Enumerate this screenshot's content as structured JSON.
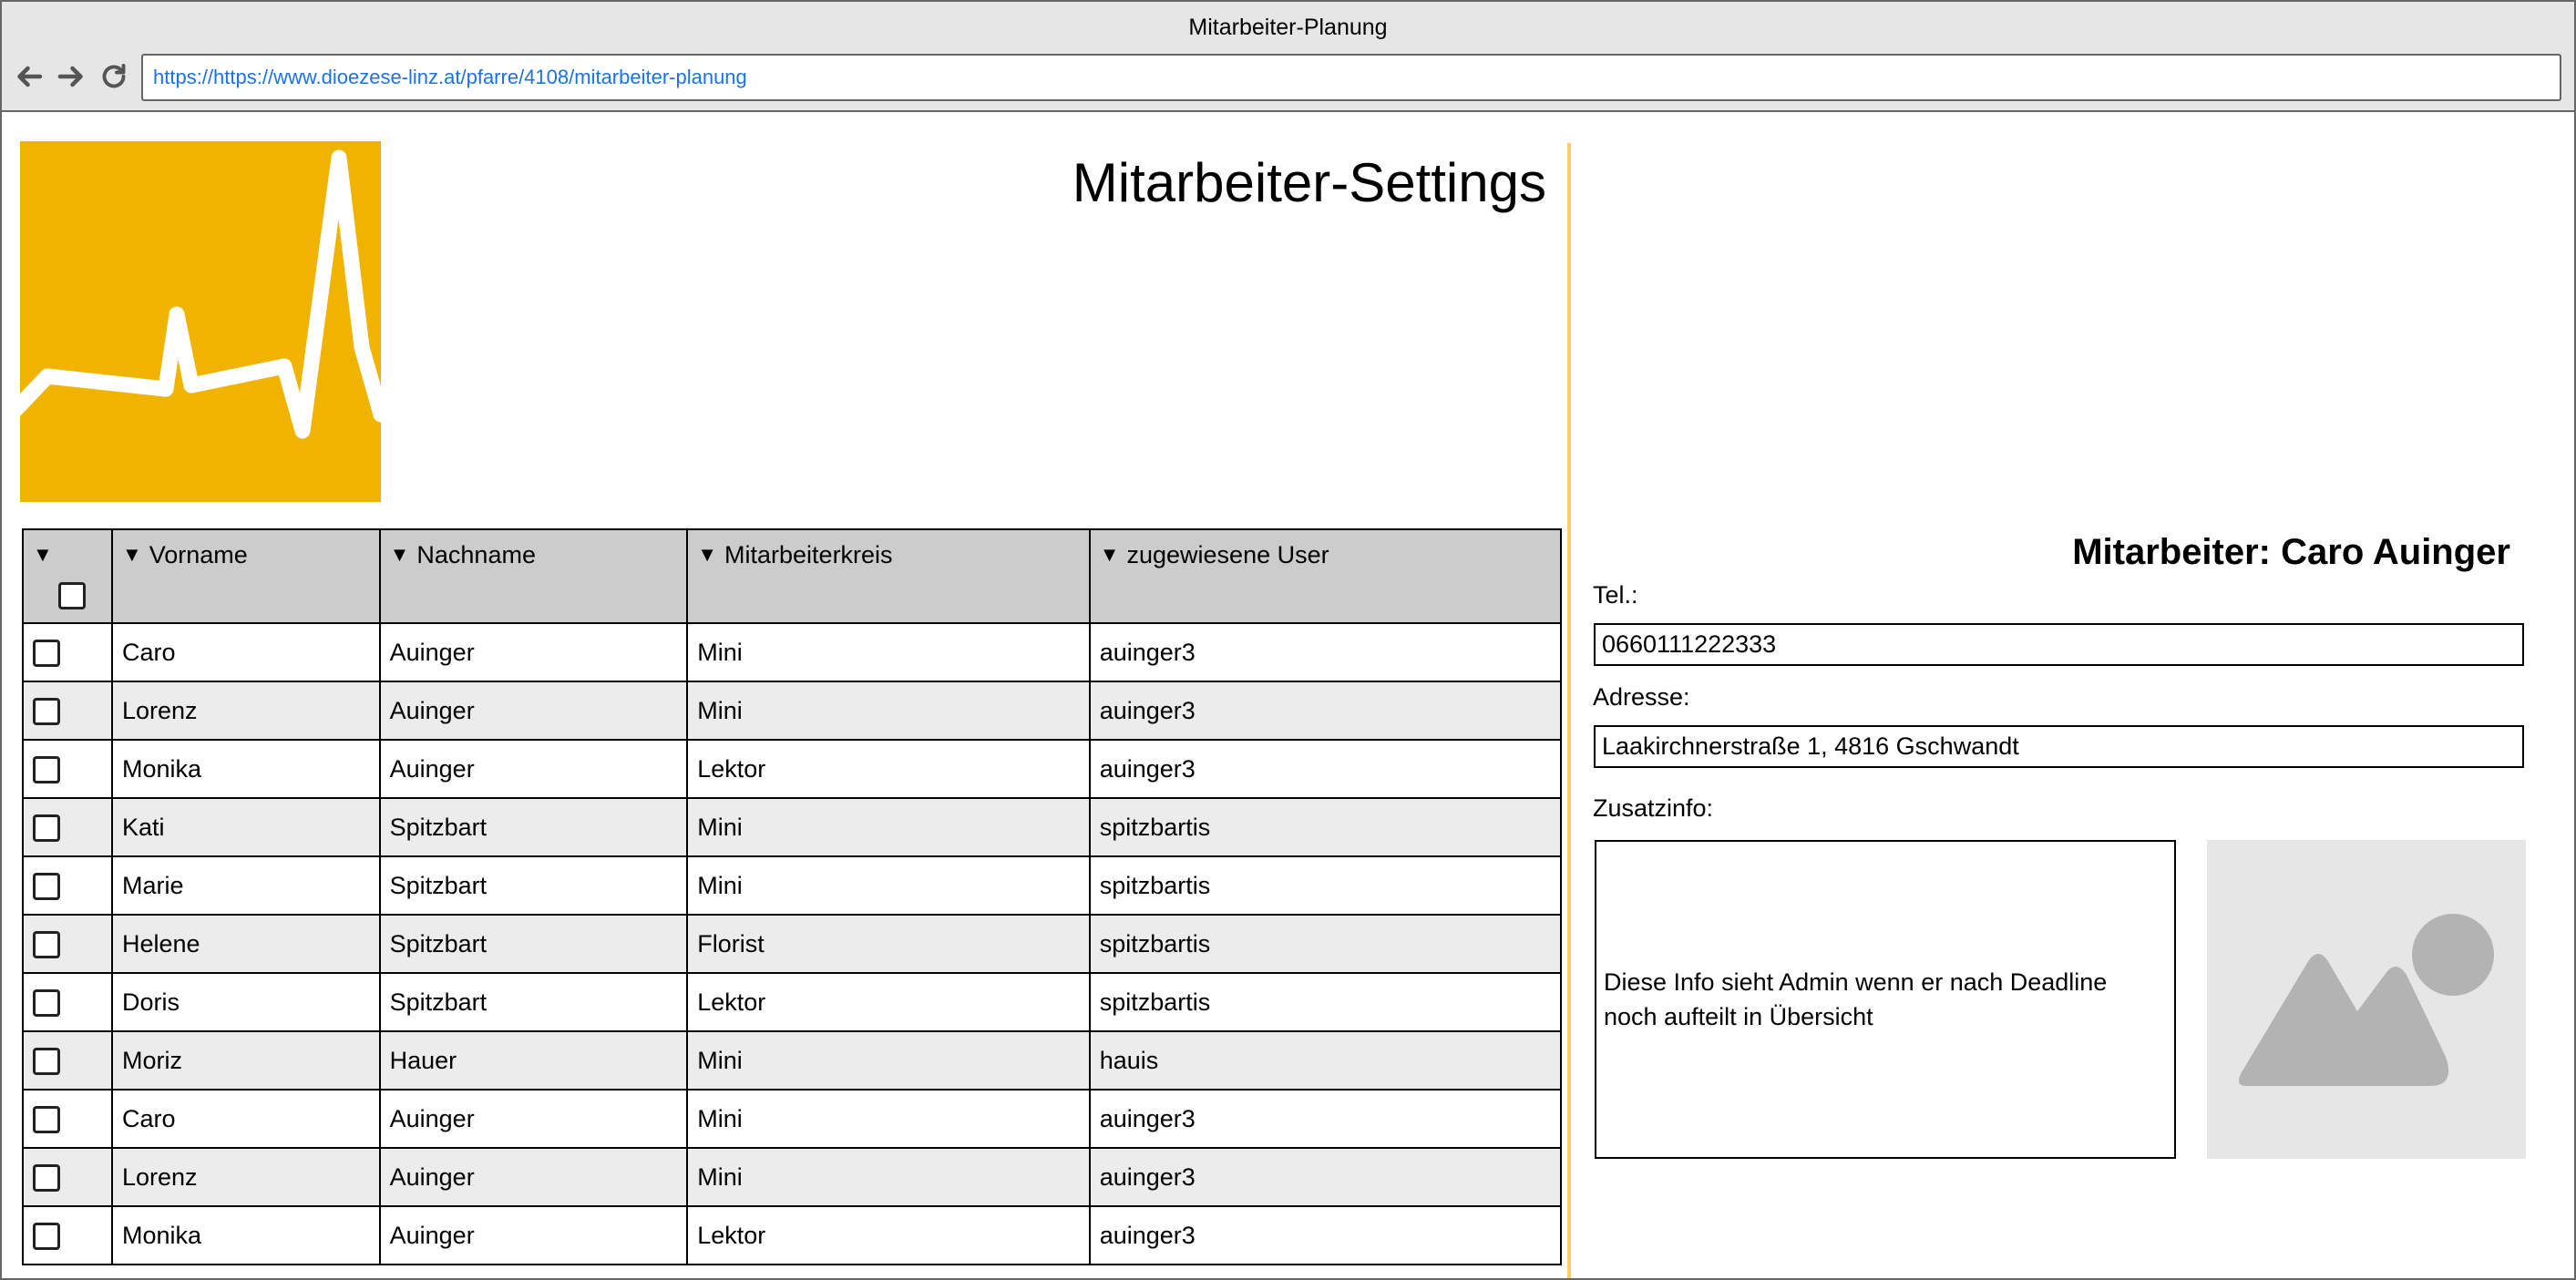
{
  "window": {
    "title": "Mitarbeiter-Planung",
    "url": "https://https://www.dioezese-linz.at/pfarre/4108/mitarbeiter-planung"
  },
  "icons": {
    "back": "arrow-left-icon",
    "forward": "arrow-right-icon",
    "reload": "reload-icon",
    "logo": "pulse-logo-icon",
    "image": "image-placeholder-icon"
  },
  "colors": {
    "logo_bg": "#f0b400",
    "divider": "#ffcc66",
    "header_bg": "#cccccc",
    "alt_row": "#ececec",
    "url_text": "#1a73e8"
  },
  "page": {
    "title": "Mitarbeiter-Settings"
  },
  "table": {
    "headers": [
      "Vorname",
      "Nachname",
      "Mitarbeiterkreis",
      "zugewiesene User"
    ],
    "rows": [
      [
        "Caro",
        "Auinger",
        "Mini",
        "auinger3"
      ],
      [
        "Lorenz",
        "Auinger",
        "Mini",
        "auinger3"
      ],
      [
        "Monika",
        "Auinger",
        "Lektor",
        "auinger3"
      ],
      [
        "Kati",
        "Spitzbart",
        "Mini",
        "spitzbartis"
      ],
      [
        "Marie",
        "Spitzbart",
        "Mini",
        "spitzbartis"
      ],
      [
        "Helene",
        "Spitzbart",
        "Florist",
        "spitzbartis"
      ],
      [
        "Doris",
        "Spitzbart",
        "Lektor",
        "spitzbartis"
      ],
      [
        "Moriz",
        "Hauer",
        "Mini",
        "hauis"
      ],
      [
        "Caro",
        "Auinger",
        "Mini",
        "auinger3"
      ],
      [
        "Lorenz",
        "Auinger",
        "Mini",
        "auinger3"
      ],
      [
        "Monika",
        "Auinger",
        "Lektor",
        "auinger3"
      ]
    ]
  },
  "detail": {
    "heading": "Mitarbeiter: Caro Auinger",
    "tel_label": "Tel.:",
    "tel_value": "0660111222333",
    "address_label": "Adresse:",
    "address_value": "Laakirchnerstraße 1, 4816 Gschwandt",
    "info_label": "Zusatzinfo:",
    "info_text": "Diese Info sieht Admin wenn er nach Deadline noch aufteilt in Übersicht"
  }
}
